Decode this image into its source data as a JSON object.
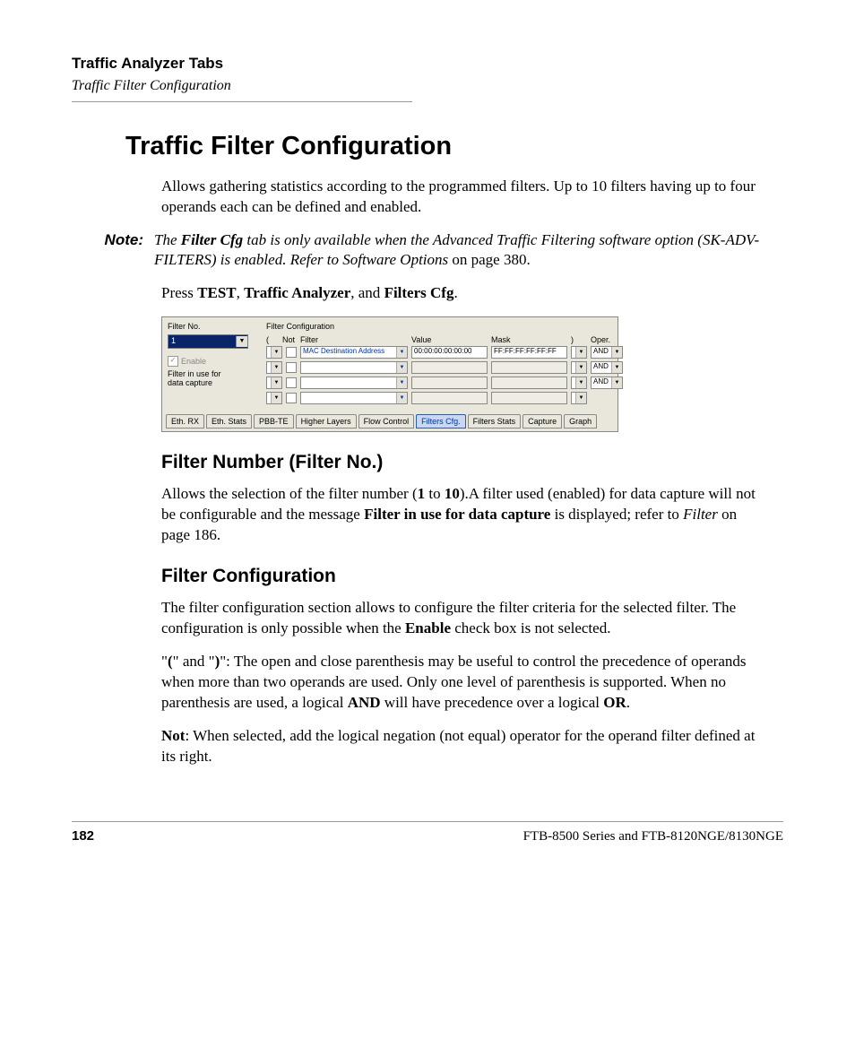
{
  "header": {
    "chapter": "Traffic Analyzer Tabs",
    "section": "Traffic Filter Configuration"
  },
  "h1": "Traffic Filter Configuration",
  "intro": "Allows gathering statistics according to the programmed filters. Up to 10 filters having up to four operands each can be defined and enabled.",
  "note": {
    "label": "Note:",
    "part1": "The ",
    "bold1": "Filter Cfg",
    "part2": " tab is only available when the Advanced Traffic Filtering software option (SK-ADV-FILTERS) is enabled. Refer to Software Options ",
    "plain": "on page 380",
    "dot": "."
  },
  "press": {
    "pre": "Press ",
    "b1": "TEST",
    "c1": ", ",
    "b2": "Traffic Analyzer",
    "c2": ", and ",
    "b3": "Filters Cfg",
    "end": "."
  },
  "screenshot": {
    "left": {
      "label": "Filter No.",
      "value": "1",
      "enable": "Enable",
      "msg1": "Filter in use for",
      "msg2": "data capture"
    },
    "title": "Filter Configuration",
    "hdr": {
      "paren_l": "(",
      "not": "Not",
      "filter": "Filter",
      "value": "Value",
      "mask": "Mask",
      "paren_r": ")",
      "oper": "Oper."
    },
    "rows": [
      {
        "filter": "MAC Destination Address",
        "value": "00:00:00:00:00:00",
        "mask": "FF:FF:FF:FF:FF:FF",
        "oper": "AND"
      },
      {
        "filter": "",
        "value": "",
        "mask": "",
        "oper": "AND"
      },
      {
        "filter": "",
        "value": "",
        "mask": "",
        "oper": "AND"
      },
      {
        "filter": "",
        "value": "",
        "mask": "",
        "oper": ""
      }
    ],
    "tabs": [
      "Eth. RX",
      "Eth. Stats",
      "PBB-TE",
      "Higher Layers",
      "Flow Control",
      "Filters Cfg.",
      "Filters Stats",
      "Capture",
      "Graph"
    ],
    "active_tab": "Filters Cfg."
  },
  "section1": {
    "title": "Filter Number (Filter No.)",
    "p1a": "Allows the selection of the filter number (",
    "p1b": "1",
    "p1c": " to ",
    "p1d": "10",
    "p1e": ").A filter used (enabled) for data capture will not be configurable and the message ",
    "p1f": "Filter in use for data capture",
    "p1g": " is displayed; refer to ",
    "p1h": "Filter",
    "p1i": " on page 186."
  },
  "section2": {
    "title": "Filter Configuration",
    "p1a": "The filter configuration section allows to configure the filter criteria for the selected filter. The configuration is only possible when the ",
    "p1b": "Enable",
    "p1c": " check box is not selected.",
    "p2a": "\"",
    "p2b": "(",
    "p2c": "\" and \"",
    "p2d": ")",
    "p2e": "\": The open and close parenthesis may be useful to control the precedence of operands when more than two operands are used. Only one level of parenthesis is supported. When no parenthesis are used, a logical ",
    "p2f": "AND",
    "p2g": " will have precedence over a logical ",
    "p2h": "OR",
    "p2i": ".",
    "p3a": "Not",
    "p3b": ": When selected, add the logical negation (not equal) operator for the operand filter defined at its right."
  },
  "footer": {
    "page": "182",
    "doc": "FTB-8500 Series and FTB-8120NGE/8130NGE"
  }
}
